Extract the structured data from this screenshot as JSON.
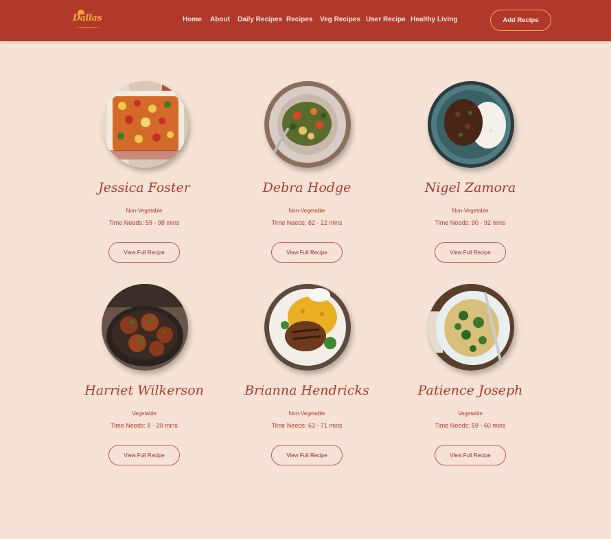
{
  "brand": {
    "logo_text": "Dallas"
  },
  "nav": {
    "items": [
      {
        "label": "Home"
      },
      {
        "label": "About"
      },
      {
        "label": "Daily Recipes"
      },
      {
        "label": "Recipes"
      },
      {
        "label": "Veg Recipes"
      },
      {
        "label": "User Recipe"
      },
      {
        "label": "Healthy Living"
      }
    ],
    "add_button": "Add Recipe"
  },
  "recipes": [
    {
      "name": "Jessica Foster",
      "type": "Non-Vegetable",
      "time": "Time Needs: 59 - 98 mins",
      "button": "View Full Recipe",
      "image": "baked-casserole"
    },
    {
      "name": "Debra Hodge",
      "type": "Non-Vegetable",
      "time": "Time Needs: 82 - 22 mins",
      "button": "View Full Recipe",
      "image": "veggie-stir-fry"
    },
    {
      "name": "Nigel Zamora",
      "type": "Non-Vegetable",
      "time": "Time Needs: 90 - 92 mins",
      "button": "View Full Recipe",
      "image": "mince-with-rice"
    },
    {
      "name": "Harriet Wilkerson",
      "type": "Vegetable",
      "time": "Time Needs: 8 - 20 mins",
      "button": "View Full Recipe",
      "image": "glazed-meatballs"
    },
    {
      "name": "Brianna Hendricks",
      "type": "Non-Vegetable",
      "time": "Time Needs: 63 - 71 mins",
      "button": "View Full Recipe",
      "image": "grilled-chicken-rice"
    },
    {
      "name": "Patience Joseph",
      "type": "Vegetable",
      "time": "Time Needs: 59 - 60 mins",
      "button": "View Full Recipe",
      "image": "pasta-with-greens"
    }
  ],
  "colors": {
    "header": "#b0392b",
    "background": "#f6e3d6",
    "accent": "#f0a93a",
    "text": "#b0392b"
  }
}
